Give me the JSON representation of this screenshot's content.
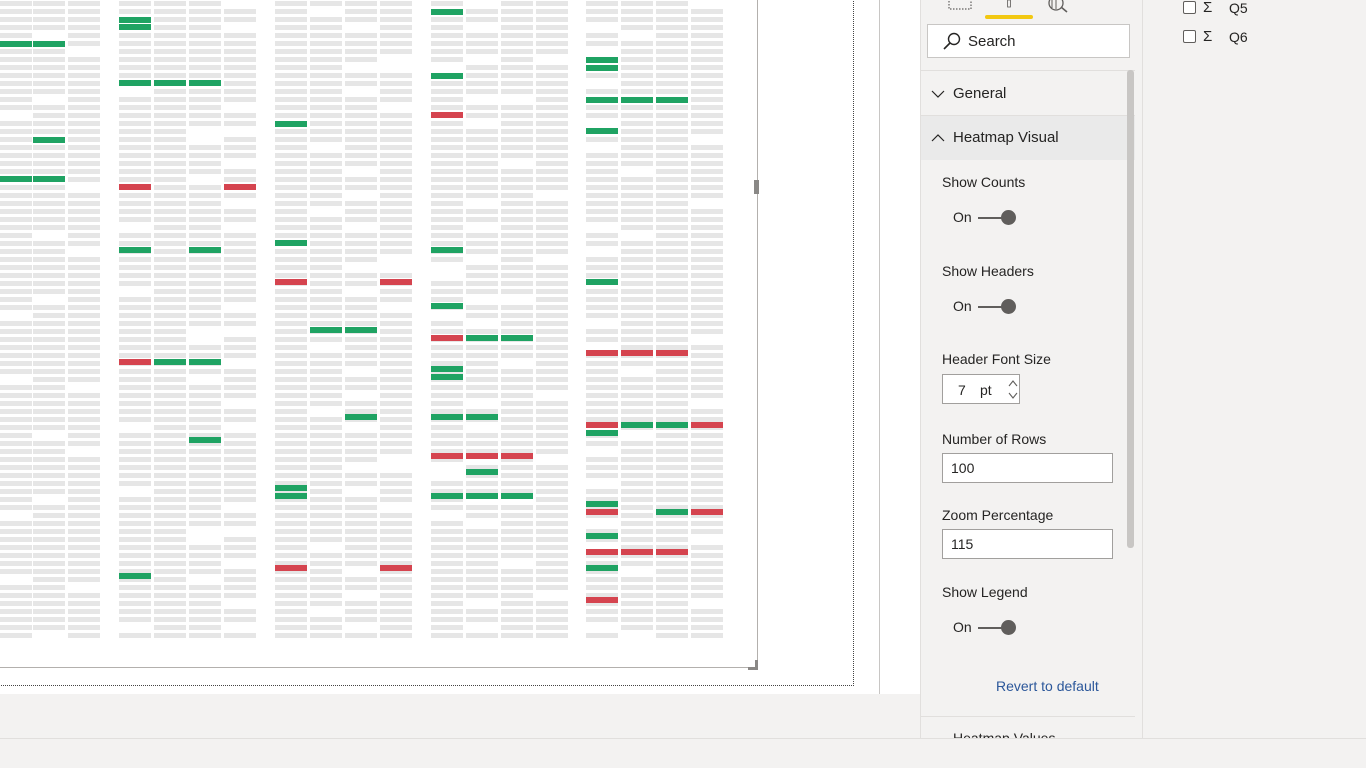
{
  "colors": {
    "cell_empty": "#e6e6e6",
    "cell_positive": "#1fa363",
    "cell_negative": "#d5444f",
    "pane_bg": "#f3f2f1",
    "tab_active_underline": "#f2c811",
    "link": "#2b579a"
  },
  "format_pane": {
    "tabs": [
      {
        "icon": "fields-tab-icon"
      },
      {
        "icon": "format-paint-roller-icon",
        "active": true
      },
      {
        "icon": "analytics-magnifier-icon"
      }
    ],
    "search": {
      "placeholder": "Search",
      "icon": "search-icon"
    },
    "sections": {
      "general": {
        "label": "General",
        "expanded": false
      },
      "heatmap": {
        "label": "Heatmap Visual",
        "expanded": true
      },
      "next_partial": {
        "label": "Heatmap Values"
      }
    },
    "props": {
      "show_counts": {
        "label": "Show Counts",
        "value": "On"
      },
      "show_headers": {
        "label": "Show Headers",
        "value": "On"
      },
      "header_font_size": {
        "label": "Header Font Size",
        "value": "7",
        "unit": "pt"
      },
      "number_of_rows": {
        "label": "Number of Rows",
        "value": "100"
      },
      "zoom_percentage": {
        "label": "Zoom Percentage",
        "value": "115"
      },
      "show_legend": {
        "label": "Show Legend",
        "value": "On"
      }
    },
    "revert": "Revert to default"
  },
  "fields_pane": {
    "fields": [
      {
        "name": "Q5",
        "checked": false,
        "icon": "sigma-icon"
      },
      {
        "name": "Q6",
        "checked": false,
        "icon": "sigma-icon"
      }
    ],
    "sigma_glyph": "Σ"
  },
  "heatmap": {
    "colored_cells": {
      "positive": [
        [
          0,
          41
        ],
        [
          1,
          41
        ],
        [
          0,
          176
        ],
        [
          1,
          176
        ],
        [
          1,
          137
        ],
        [
          3,
          17
        ],
        [
          3,
          24
        ],
        [
          3,
          80
        ],
        [
          4,
          80
        ],
        [
          5,
          80
        ],
        [
          3,
          247
        ],
        [
          5,
          247
        ],
        [
          4,
          359
        ],
        [
          5,
          359
        ],
        [
          5,
          437
        ],
        [
          3,
          573
        ],
        [
          7,
          121
        ],
        [
          7,
          240
        ],
        [
          8,
          327
        ],
        [
          9,
          327
        ],
        [
          9,
          414
        ],
        [
          7,
          485
        ],
        [
          7,
          493
        ],
        [
          11,
          9
        ],
        [
          11,
          73
        ],
        [
          11,
          247
        ],
        [
          11,
          303
        ],
        [
          11,
          366
        ],
        [
          11,
          374
        ],
        [
          12,
          335
        ],
        [
          13,
          335
        ],
        [
          11,
          414
        ],
        [
          12,
          414
        ],
        [
          12,
          469
        ],
        [
          11,
          493
        ],
        [
          12,
          493
        ],
        [
          13,
          493
        ],
        [
          15,
          57
        ],
        [
          15,
          65
        ],
        [
          15,
          97
        ],
        [
          16,
          97
        ],
        [
          17,
          97
        ],
        [
          15,
          128
        ],
        [
          15,
          279
        ],
        [
          16,
          422
        ],
        [
          17,
          422
        ],
        [
          15,
          430
        ],
        [
          15,
          501
        ],
        [
          17,
          509
        ],
        [
          15,
          533
        ],
        [
          15,
          565
        ]
      ],
      "negative": [
        [
          3,
          184
        ],
        [
          6,
          184
        ],
        [
          3,
          359
        ],
        [
          7,
          279
        ],
        [
          10,
          279
        ],
        [
          7,
          565
        ],
        [
          10,
          565
        ],
        [
          11,
          112
        ],
        [
          11,
          335
        ],
        [
          11,
          453
        ],
        [
          12,
          453
        ],
        [
          13,
          453
        ],
        [
          15,
          350
        ],
        [
          16,
          350
        ],
        [
          17,
          350
        ],
        [
          15,
          422
        ],
        [
          18,
          422
        ],
        [
          15,
          509
        ],
        [
          18,
          509
        ],
        [
          15,
          549
        ],
        [
          16,
          549
        ],
        [
          17,
          549
        ],
        [
          15,
          597
        ]
      ]
    }
  }
}
